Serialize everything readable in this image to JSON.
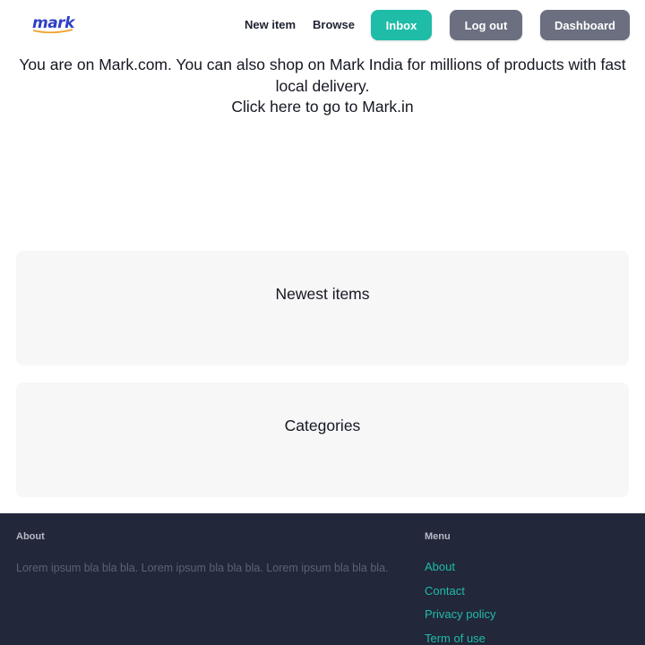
{
  "navbar": {
    "logo_text": "mark",
    "links": {
      "new_item": "New item",
      "browse": "Browse"
    },
    "buttons": {
      "inbox": "Inbox",
      "logout": "Log out",
      "dashboard": "Dashboard"
    }
  },
  "notice": {
    "line1": "You are on Mark.com. You can also shop on Mark India for millions of products with fast local delivery.",
    "link": "Click here to go to Mark.in"
  },
  "sections": {
    "newest": "Newest items",
    "categories": "Categories"
  },
  "footer": {
    "about_heading": "About",
    "about_text": "Lorem ipsum bla bla bla. Lorem ipsum bla bla bla. Lorem ipsum bla bla bla.",
    "menu_heading": "Menu",
    "menu": [
      "About",
      "Contact",
      "Privacy policy",
      "Term of use"
    ]
  },
  "colors": {
    "brand": "#2f3fc4",
    "accent": "#1fbca8",
    "button_gray": "#6b6f80",
    "footer_bg": "#22273a",
    "card_bg": "#f7f7f7"
  },
  "icons": {
    "logo": "mark-logo-swoosh"
  }
}
